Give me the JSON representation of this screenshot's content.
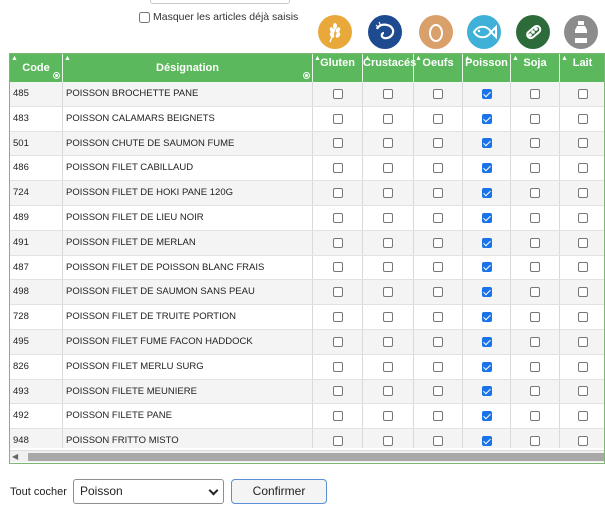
{
  "filter": {
    "mask_label": "Masquer les articles déjà saisis",
    "mask_checked": false
  },
  "allergen_icons": [
    {
      "name": "wheat-icon",
      "color": "#e8a83a"
    },
    {
      "name": "shrimp-icon",
      "color": "#1e4b8f"
    },
    {
      "name": "egg-icon",
      "color": "#d9a06b"
    },
    {
      "name": "fish-icon",
      "color": "#3fb0d8"
    },
    {
      "name": "soy-icon",
      "color": "#2e6b3a"
    },
    {
      "name": "milk-bottle-icon",
      "color": "#8c8c8c"
    }
  ],
  "table": {
    "headers": {
      "code": "Code",
      "designation": "Désignation",
      "allergens": [
        "Gluten",
        "Crustacés",
        "Oeufs",
        "Poisson",
        "Soja",
        "Lait"
      ]
    },
    "rows": [
      {
        "code": "485",
        "designation": "POISSON BROCHETTE PANE",
        "checks": [
          false,
          false,
          false,
          true,
          false,
          false
        ]
      },
      {
        "code": "483",
        "designation": "POISSON CALAMARS BEIGNETS",
        "checks": [
          false,
          false,
          false,
          true,
          false,
          false
        ]
      },
      {
        "code": "501",
        "designation": "POISSON CHUTE DE SAUMON FUME",
        "checks": [
          false,
          false,
          false,
          true,
          false,
          false
        ]
      },
      {
        "code": "486",
        "designation": "POISSON FILET CABILLAUD",
        "checks": [
          false,
          false,
          false,
          true,
          false,
          false
        ]
      },
      {
        "code": "724",
        "designation": "POISSON FILET DE HOKI PANE 120G",
        "checks": [
          false,
          false,
          false,
          true,
          false,
          false
        ]
      },
      {
        "code": "489",
        "designation": "POISSON FILET DE LIEU NOIR",
        "checks": [
          false,
          false,
          false,
          true,
          false,
          false
        ]
      },
      {
        "code": "491",
        "designation": "POISSON FILET DE MERLAN",
        "checks": [
          false,
          false,
          false,
          true,
          false,
          false
        ]
      },
      {
        "code": "487",
        "designation": "POISSON FILET DE POISSON BLANC FRAIS",
        "checks": [
          false,
          false,
          false,
          true,
          false,
          false
        ]
      },
      {
        "code": "498",
        "designation": "POISSON FILET DE SAUMON SANS PEAU",
        "checks": [
          false,
          false,
          false,
          true,
          false,
          false
        ]
      },
      {
        "code": "728",
        "designation": "POISSON FILET DE TRUITE PORTION",
        "checks": [
          false,
          false,
          false,
          true,
          false,
          false
        ]
      },
      {
        "code": "495",
        "designation": "POISSON FILET FUME FACON HADDOCK",
        "checks": [
          false,
          false,
          false,
          true,
          false,
          false
        ]
      },
      {
        "code": "826",
        "designation": "POISSON FILET MERLU SURG",
        "checks": [
          false,
          false,
          false,
          true,
          false,
          false
        ]
      },
      {
        "code": "493",
        "designation": "POISSON FILETE MEUNIERE",
        "checks": [
          false,
          false,
          false,
          true,
          false,
          false
        ]
      },
      {
        "code": "492",
        "designation": "POISSON FILETE PANE",
        "checks": [
          false,
          false,
          false,
          true,
          false,
          false
        ]
      },
      {
        "code": "948",
        "designation": "POISSON FRITTO MISTO",
        "checks": [
          false,
          false,
          false,
          true,
          false,
          false
        ]
      }
    ]
  },
  "bottom": {
    "label": "Tout cocher",
    "select_value": "Poisson",
    "confirm_label": "Confirmer"
  }
}
